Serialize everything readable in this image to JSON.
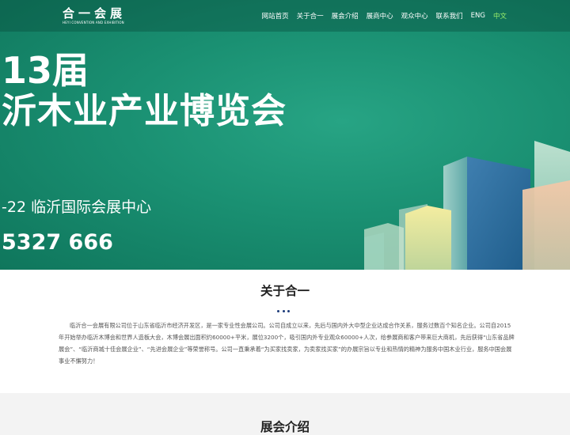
{
  "header": {
    "logo_cn": "合一会展",
    "logo_en": "HEYI CONVENTION AND EXHIBITION",
    "nav": [
      {
        "label": "网站首页"
      },
      {
        "label": "关于合一"
      },
      {
        "label": "展会介绍"
      },
      {
        "label": "展商中心"
      },
      {
        "label": "观众中心"
      },
      {
        "label": "联系我们"
      },
      {
        "label": "ENG"
      },
      {
        "label": "中文",
        "active": true
      }
    ]
  },
  "hero": {
    "edition": "13届",
    "title": "沂木业产业博览会",
    "date_venue": "-22 临沂国际会展中心",
    "phone": "5327 666"
  },
  "about": {
    "title": "关于合一",
    "body": "临沂合一会展有限公司位于山东省临沂市经济开发区，是一家专业性会展公司。公司自成立以来，先后与国内外大中型企业达成合作关系，服务过数百个知名企业。公司自2015年开始举办临沂木博会和世界人造板大会，木博会展出面积约60000+平米，展位3200个，吸引国内外专业观众60000+人次，给参展商和客户带来巨大商机，先后获得“山东省品牌展会”、“临沂商城十佳会展企业”、“先进会展企业”等荣誉称号。公司一直秉承着“为买家找卖家，为卖家找买家”的办展宗旨以专业和热情的精神为服务中国木业行业，服务中国会展事业不懈努力！"
  },
  "expo": {
    "title": "展会介绍"
  },
  "colors": {
    "hero_green": "#1a9072",
    "nav_active": "#9bf06b",
    "dot_blue": "#1e3c7a"
  }
}
